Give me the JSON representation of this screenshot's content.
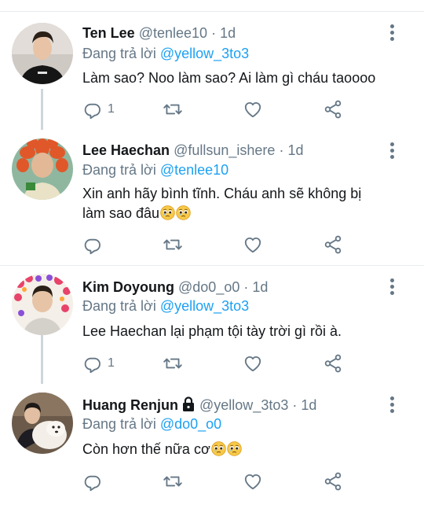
{
  "tweets": [
    {
      "name": "Ten Lee",
      "handle": "@tenlee10",
      "time": "1d",
      "reply_prefix": "Đang trả lời",
      "reply_to": "@yellow_3to3",
      "text": "Làm sao? Noo làm sao? Ai làm gì cháu taoooo",
      "reply_count": "1",
      "avatar_icon": "profile-photo"
    },
    {
      "name": "Lee Haechan",
      "handle": "@fullsun_ishere",
      "time": "1d",
      "reply_prefix": "Đang trả lời",
      "reply_to": "@tenlee10",
      "text_line1": "Xin anh hãy bình tĩnh. Cháu anh sẽ không bị",
      "text_line2": "làm sao đâu",
      "reply_count": "",
      "avatar_icon": "profile-photo"
    },
    {
      "name": "Kim Doyoung",
      "handle": "@do0_o0",
      "time": "1d",
      "reply_prefix": "Đang trả lời",
      "reply_to": "@yellow_3to3",
      "text": "Lee Haechan lại phạm tội tày trời gì rồi à.",
      "reply_count": "1",
      "avatar_icon": "profile-photo"
    },
    {
      "name": "Huang Renjun",
      "handle": "@yellow_3to3",
      "time": "1d",
      "reply_prefix": "Đang trả lời",
      "reply_to": "@do0_o0",
      "text": "Còn hơn thế nữa cơ",
      "reply_count": "",
      "avatar_icon": "profile-photo",
      "protected": true
    }
  ],
  "separator_dot": "·",
  "icons": {
    "reply": "reply-icon",
    "retweet": "retweet-icon",
    "like": "heart-icon",
    "share": "share-icon",
    "more": "more-vertical-icon",
    "emoji": "pleading-face-emoji",
    "lock": "lock-icon"
  },
  "colors": {
    "accent": "#1da1f2",
    "secondary_text": "#657786",
    "border": "#e6ecf0",
    "thread_line": "#ccd6dd"
  }
}
